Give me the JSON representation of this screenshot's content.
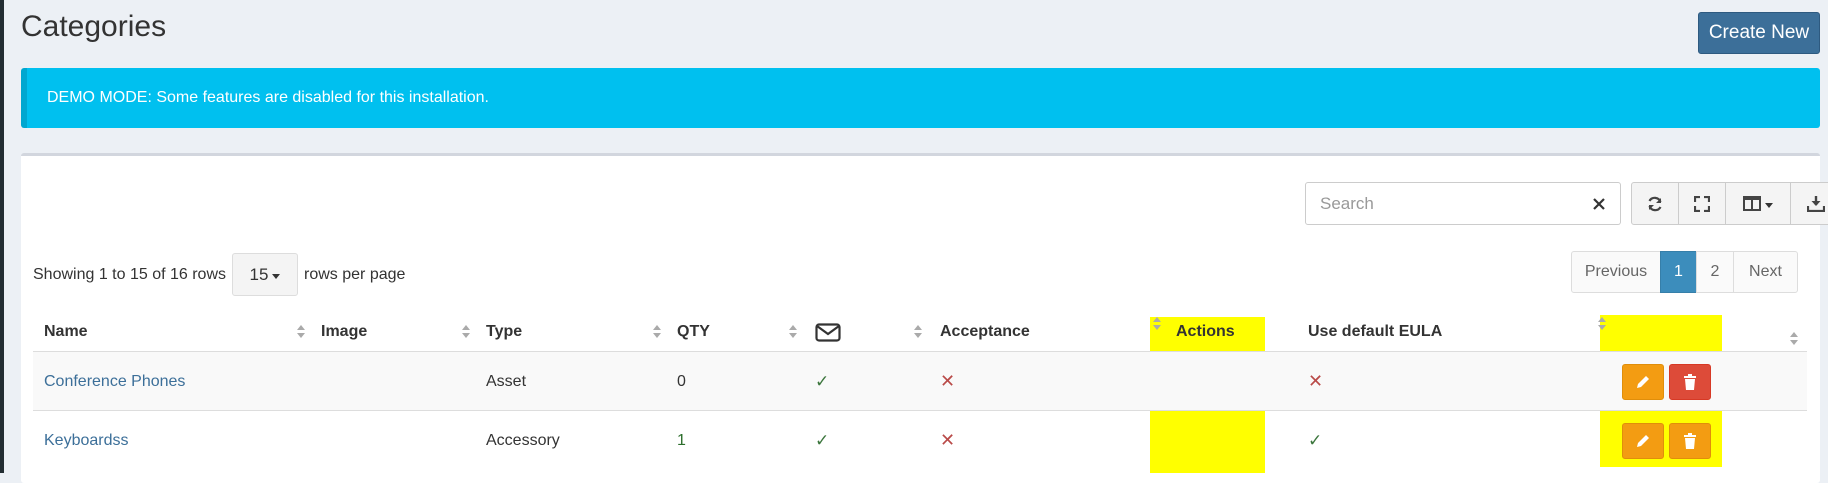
{
  "page": {
    "title": "Categories",
    "create_button": "Create New"
  },
  "alert": {
    "text": "DEMO MODE: Some features are disabled for this installation."
  },
  "toolbar": {
    "search_placeholder": "Search",
    "icons": [
      "close-icon",
      "refresh-icon",
      "fullscreen-icon",
      "columns-icon",
      "download-icon"
    ]
  },
  "pagination": {
    "showing": "Showing 1 to 15 of 16 rows",
    "page_size": "15",
    "rows_per_page": "rows per page",
    "previous": "Previous",
    "pages": [
      "1",
      "2"
    ],
    "current_page": "1",
    "next": "Next"
  },
  "table": {
    "columns": {
      "name": "Name",
      "image": "Image",
      "type": "Type",
      "qty": "QTY",
      "email_icon": "envelope-icon",
      "acceptance": "Acceptance",
      "actions": "Actions",
      "eula": "Use default EULA"
    },
    "rows": [
      {
        "name": "Conference Phones",
        "image": "",
        "type": "Asset",
        "qty": "0",
        "email": true,
        "acceptance": false,
        "eula": false
      },
      {
        "name": "Keyboardss",
        "image": "",
        "type": "Accessory",
        "qty": "1",
        "email": true,
        "acceptance": false,
        "eula": true
      }
    ]
  },
  "colors": {
    "alert_bg": "#00c0ef",
    "primary": "#3c8dbc",
    "create_button": "#3c6f99",
    "highlight": "#ffff00",
    "edit_button": "#f39c12",
    "delete_button": "#dd4b39"
  }
}
